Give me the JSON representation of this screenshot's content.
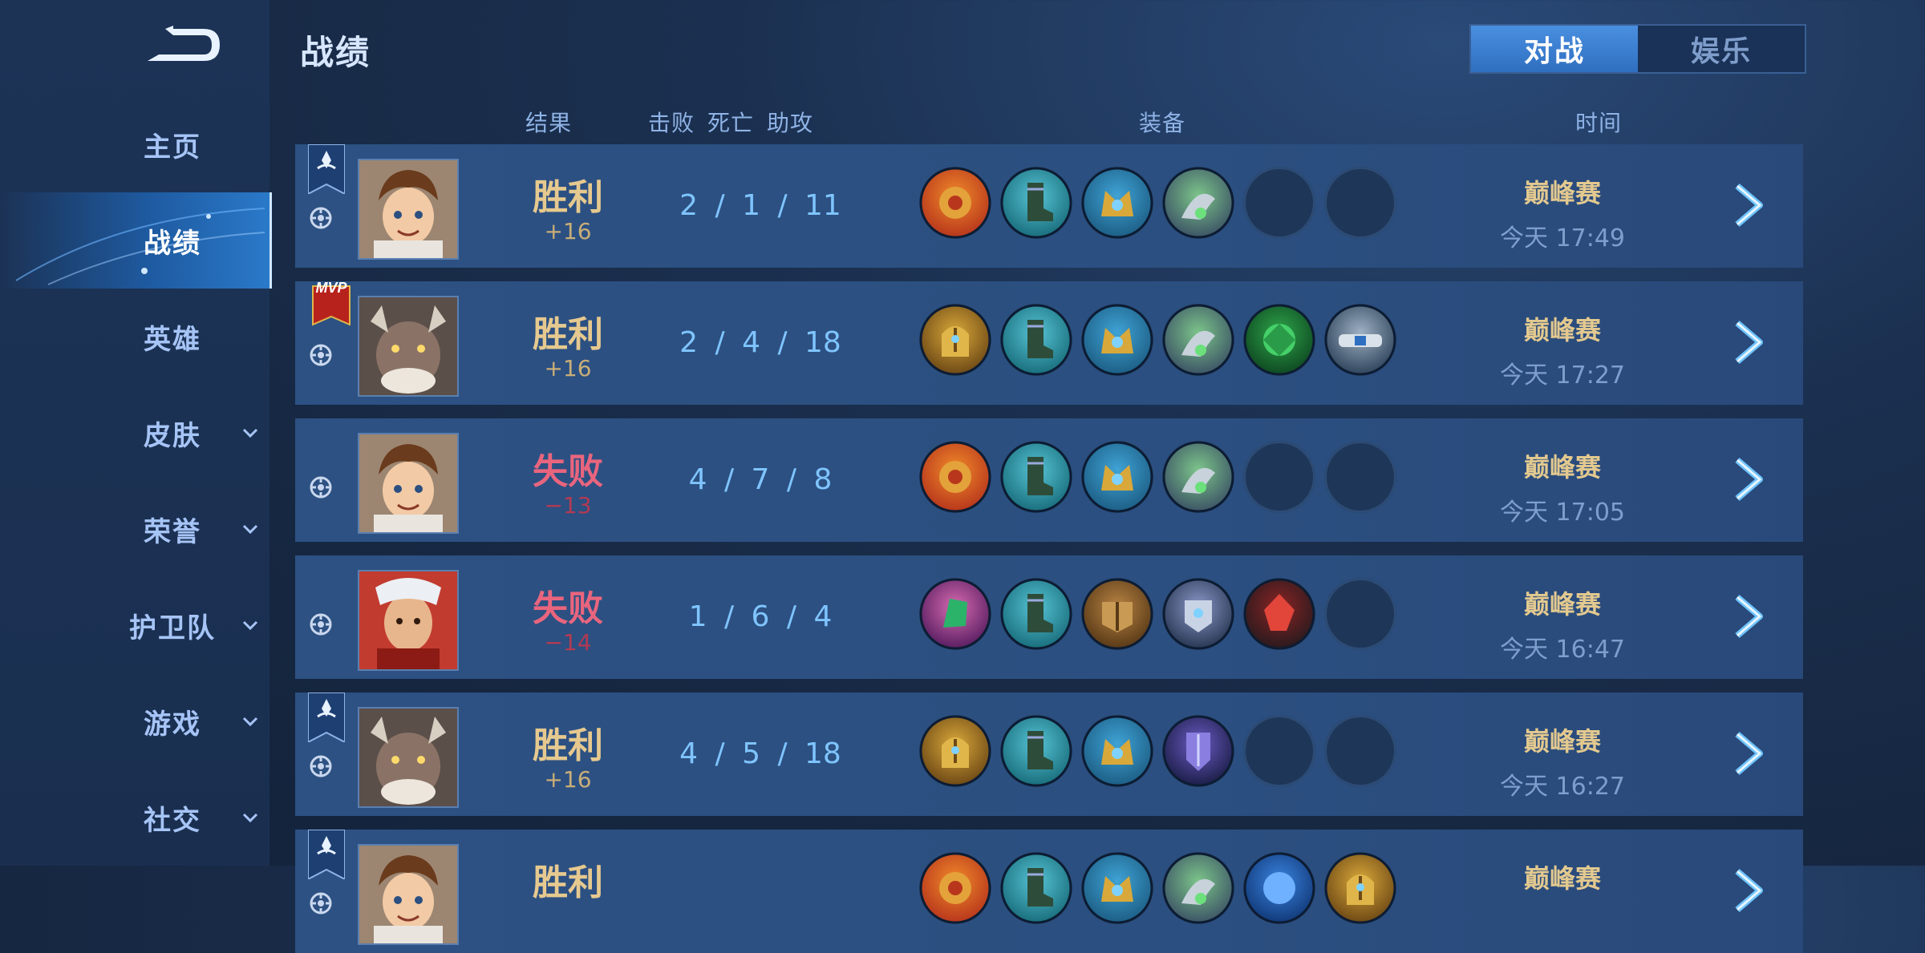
{
  "header": {
    "title": "战绩"
  },
  "tabs": [
    {
      "label": "对战",
      "active": true
    },
    {
      "label": "娱乐",
      "active": false
    }
  ],
  "columns": {
    "result": "结果",
    "kills": "击败",
    "deaths": "死亡",
    "assists": "助攻",
    "equipment": "装备",
    "time": "时间"
  },
  "sidebar": {
    "items": [
      {
        "label": "主页",
        "expandable": false,
        "active": false
      },
      {
        "label": "战绩",
        "expandable": false,
        "active": true
      },
      {
        "label": "英雄",
        "expandable": false,
        "active": false
      },
      {
        "label": "皮肤",
        "expandable": true,
        "active": false
      },
      {
        "label": "荣誉",
        "expandable": true,
        "active": false
      },
      {
        "label": "护卫队",
        "expandable": true,
        "active": false
      },
      {
        "label": "游戏",
        "expandable": true,
        "active": false
      },
      {
        "label": "社交",
        "expandable": true,
        "active": false
      }
    ]
  },
  "matches": [
    {
      "result": "胜利",
      "score": "+16",
      "kda": "2 / 1 / 11",
      "mode": "巅峰赛",
      "time": "今天 17:49",
      "badge": "flag",
      "hero": "hero-boy",
      "items": [
        "fire-orb",
        "teal-boots",
        "gold-crown-blue",
        "silver-green-claw",
        "empty",
        "empty"
      ]
    },
    {
      "result": "胜利",
      "score": "+16",
      "kda": "2 / 4 / 18",
      "mode": "巅峰赛",
      "time": "今天 17:27",
      "badge": "MVP",
      "hero": "hero-beast",
      "items": [
        "gold-helm",
        "teal-boots",
        "gold-crown-blue",
        "silver-green-claw",
        "green-gem",
        "silver-band"
      ]
    },
    {
      "result": "失败",
      "score": "−13",
      "kda": "4 / 7 / 8",
      "mode": "巅峰赛",
      "time": "今天 17:05",
      "badge": "",
      "hero": "hero-boy",
      "items": [
        "fire-orb",
        "teal-boots",
        "gold-crown-blue",
        "silver-green-claw",
        "empty",
        "empty"
      ]
    },
    {
      "result": "失败",
      "score": "−14",
      "kda": "1 / 6 / 4",
      "mode": "巅峰赛",
      "time": "今天 16:47",
      "badge": "",
      "hero": "hero-monkey",
      "items": [
        "emerald-crystal",
        "teal-boots",
        "brown-armor",
        "silver-armor",
        "red-crystal",
        "empty"
      ]
    },
    {
      "result": "胜利",
      "score": "+16",
      "kda": "4 / 5 / 18",
      "mode": "巅峰赛",
      "time": "今天 16:27",
      "badge": "flag",
      "hero": "hero-beast",
      "items": [
        "gold-helm",
        "teal-boots",
        "gold-crown-blue",
        "purple-armor",
        "empty",
        "empty"
      ]
    },
    {
      "result": "胜利",
      "score": "",
      "kda": "",
      "mode": "巅峰赛",
      "time": "",
      "badge": "flag",
      "hero": "hero-boy",
      "items": [
        "fire-orb",
        "teal-boots",
        "gold-crown-blue",
        "silver-green-claw",
        "blue-orb",
        "gold-helm"
      ]
    }
  ],
  "colors": {
    "win": "#e6c98f",
    "lose": "#e9657e",
    "kda": "#7fc4ff",
    "accent": "#2f6fc0"
  }
}
